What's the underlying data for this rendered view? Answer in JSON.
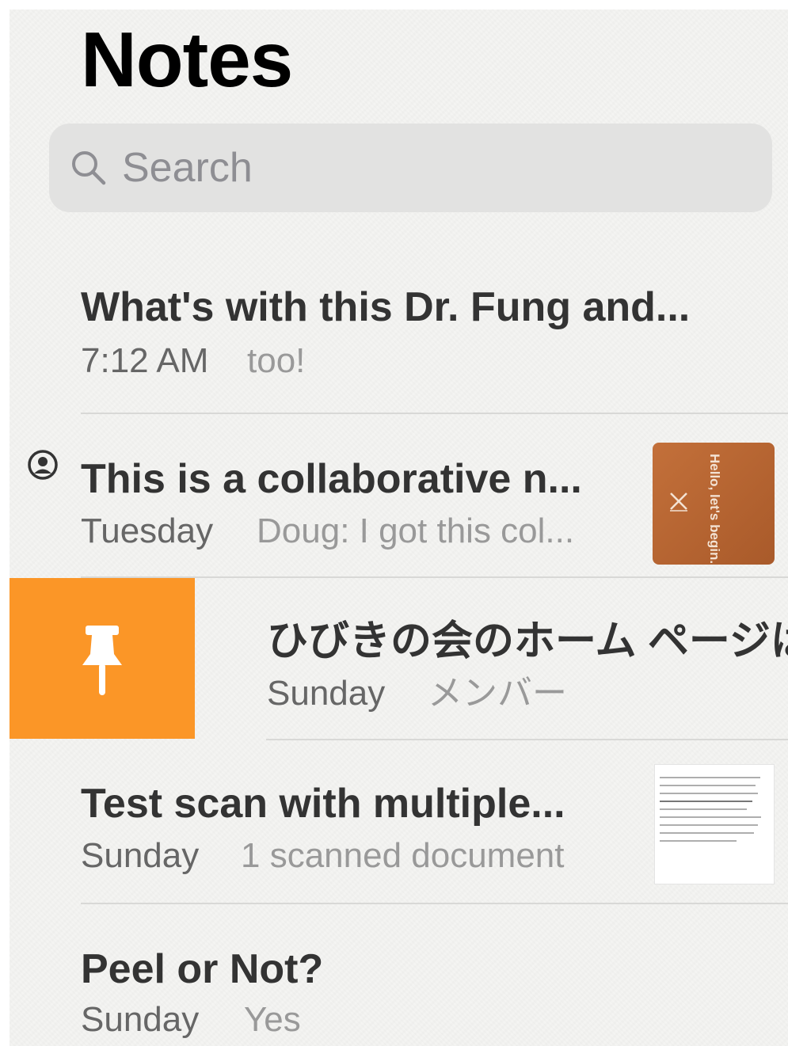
{
  "header": {
    "title": "Notes"
  },
  "search": {
    "placeholder": "Search",
    "icon": "magnifier"
  },
  "notes": [
    {
      "title": "What's with this Dr. Fung and...",
      "date": "7:12 AM",
      "snippet": "too!"
    },
    {
      "title": "This is a collaborative n...",
      "date": "Tuesday",
      "snippet": "Doug: I got this col...",
      "shared": true,
      "thumbnail_text": "Hello, let's begin."
    },
    {
      "title": "ひびきの会のホーム ページは",
      "date": "Sunday",
      "snippet": "メンバー",
      "swipe_action": "pin"
    },
    {
      "title": "Test scan with multiple...",
      "date": "Sunday",
      "snippet": "1 scanned document",
      "thumbnail": "scanned-document"
    },
    {
      "title": "Peel or Not?",
      "date": "Sunday",
      "snippet": "Yes"
    }
  ],
  "colors": {
    "accent_pin": "#fb9627",
    "thumbnail_orange": "#b5632f",
    "search_bg": "#e2e2e1"
  }
}
